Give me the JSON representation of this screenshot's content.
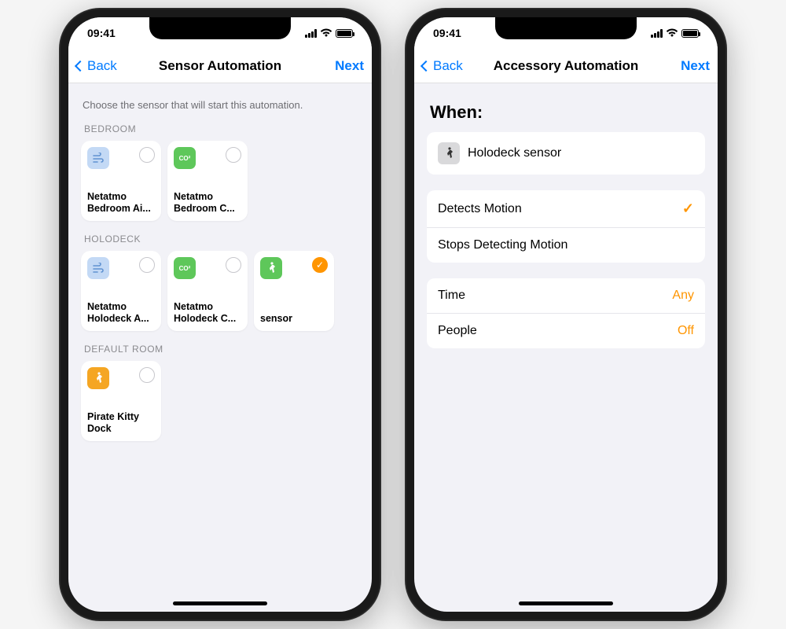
{
  "status": {
    "time": "09:41"
  },
  "left": {
    "back": "Back",
    "title": "Sensor Automation",
    "next": "Next",
    "subtitle": "Choose the sensor that will start this automation.",
    "sections": {
      "bedroom": {
        "header": "BEDROOM",
        "tiles": [
          {
            "label": "Netatmo Bedroom Ai..."
          },
          {
            "label": "Netatmo Bedroom C..."
          }
        ]
      },
      "holodeck": {
        "header": "HOLODECK",
        "tiles": [
          {
            "label": "Netatmo Holodeck A..."
          },
          {
            "label": "Netatmo Holodeck C..."
          },
          {
            "label": "sensor"
          }
        ]
      },
      "default": {
        "header": "DEFAULT ROOM",
        "tiles": [
          {
            "label": "Pirate Kitty Dock"
          }
        ]
      }
    }
  },
  "right": {
    "back": "Back",
    "title": "Accessory Automation",
    "next": "Next",
    "when_heading": "When:",
    "sensor_row": "Holodeck sensor",
    "detects": "Detects Motion",
    "stops": "Stops Detecting Motion",
    "time_label": "Time",
    "time_value": "Any",
    "people_label": "People",
    "people_value": "Off"
  }
}
